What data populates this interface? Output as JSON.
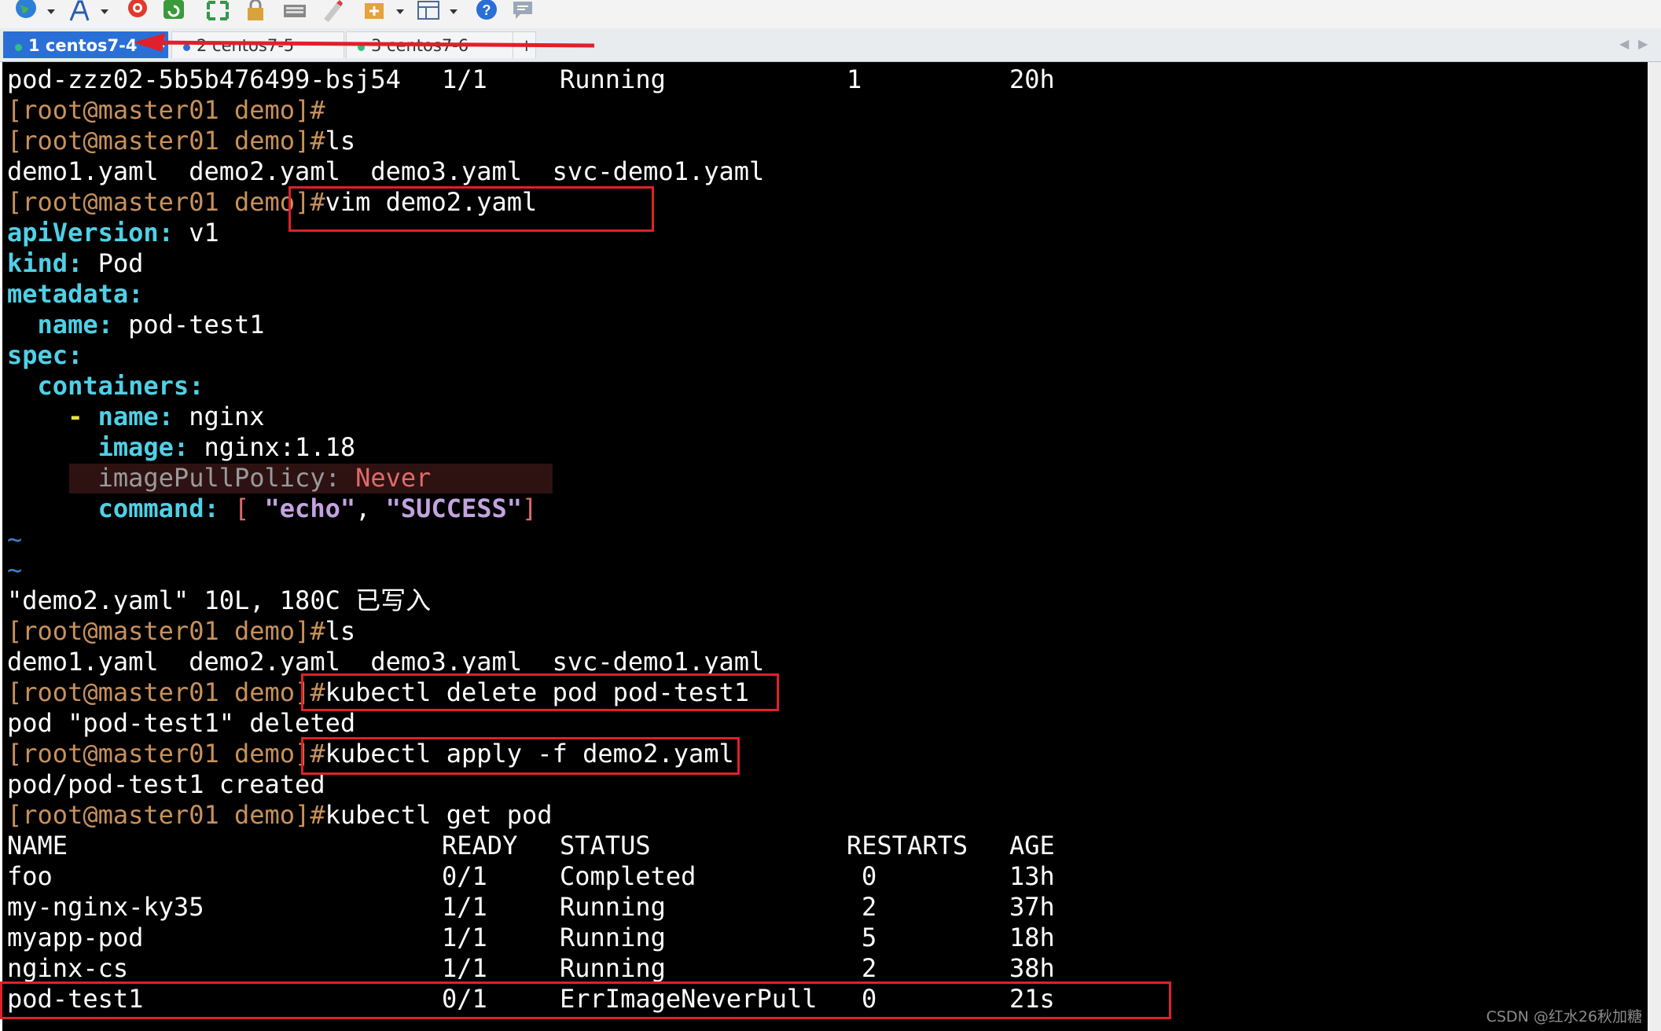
{
  "window": {
    "tabs": [
      {
        "label": "1 centos7-4",
        "active": true,
        "status_color": "#2ec27e"
      },
      {
        "label": "2 centos7-5",
        "active": false,
        "status_color": "#2a6fd6"
      },
      {
        "label": "3 centos7-6",
        "active": false,
        "status_color": "#2ec27e"
      }
    ],
    "new_tab_label": "+",
    "close_glyph": "×",
    "toolbar_icons": [
      "globe-icon",
      "font-icon",
      "swirl-icon",
      "refresh-icon",
      "fullscreen-icon",
      "lock-icon",
      "keyboard-icon",
      "pen-icon",
      "add-session-icon",
      "layout-icon",
      "help-icon",
      "chat-icon"
    ]
  },
  "terminal": {
    "prompt": "[root@master01 demo]#",
    "top_row": {
      "name": "pod-zzz02-5b5b476499-bsj54",
      "ready": "1/1",
      "status": "Running",
      "restarts": "1",
      "age": "20h"
    },
    "cmd_ls": "ls",
    "ls_output": "demo1.yaml  demo2.yaml  demo3.yaml  svc-demo1.yaml",
    "cmd_vim": "vim demo2.yaml",
    "yaml": {
      "api_key": "apiVersion",
      "api_val": "v1",
      "kind_key": "kind",
      "kind_val": "Pod",
      "metadata_key": "metadata",
      "name_key": "name",
      "name_val": "pod-test1",
      "spec_key": "spec",
      "containers_key": "containers",
      "dash": "-",
      "cname_key": "name",
      "cname_val": "nginx",
      "image_key": "image",
      "image_val": "nginx:1.18",
      "pull_key": "imagePullPolicy",
      "pull_val": "Never",
      "cmd_key": "command",
      "cmd_open": "[",
      "cmd_arg1": "\"echo\"",
      "cmd_sep": ",",
      "cmd_arg2": "\"SUCCESS\"",
      "cmd_close": "]"
    },
    "tilde": "~",
    "write_msg": "\"demo2.yaml\" 10L, 180C 已写入",
    "cmd_delete": "kubectl delete pod pod-test1",
    "delete_output": "pod \"pod-test1\" deleted",
    "cmd_apply": "kubectl apply -f demo2.yaml",
    "apply_output": "pod/pod-test1 created",
    "cmd_get": "kubectl get pod",
    "table_headers": {
      "name": "NAME",
      "ready": "READY",
      "status": "STATUS",
      "restarts": "RESTARTS",
      "age": "AGE"
    },
    "table_rows": [
      {
        "name": "foo",
        "ready": "0/1",
        "status": "Completed",
        "restarts": "0",
        "age": "13h"
      },
      {
        "name": "my-nginx-ky35",
        "ready": "1/1",
        "status": "Running",
        "restarts": "2",
        "age": "37h"
      },
      {
        "name": "myapp-pod",
        "ready": "1/1",
        "status": "Running",
        "restarts": "5",
        "age": "18h"
      },
      {
        "name": "nginx-cs",
        "ready": "1/1",
        "status": "Running",
        "restarts": "2",
        "age": "38h"
      },
      {
        "name": "pod-test1",
        "ready": "0/1",
        "status": "ErrImageNeverPull",
        "restarts": "0",
        "age": "21s"
      }
    ]
  },
  "watermark": "CSDN @红水26秋加糖",
  "colors": {
    "annotation_red": "#e0202a",
    "terminal_bg": "#000000",
    "prompt": "#c8915a",
    "yaml_key": "#4fd0e6"
  }
}
